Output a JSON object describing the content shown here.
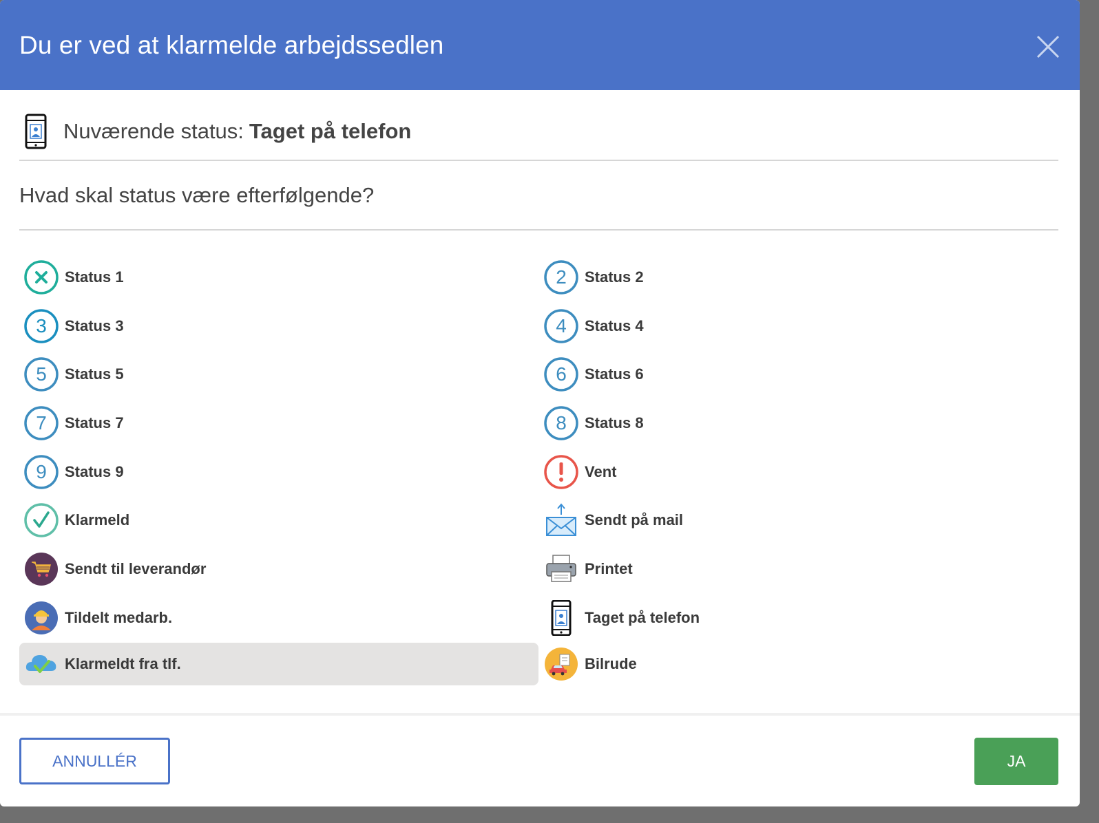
{
  "dialog": {
    "title": "Du er ved at klarmelde arbejdssedlen",
    "current_status_label": "Nuværende status:",
    "current_status_value": "Taget på telefon",
    "question": "Hvad skal status være efterfølgende?"
  },
  "options": {
    "left": [
      {
        "label": "Status 1",
        "icon": "x-circle-icon"
      },
      {
        "label": "Status 3",
        "icon": "number-3-circle-icon"
      },
      {
        "label": "Status 5",
        "icon": "number-5-circle-icon"
      },
      {
        "label": "Status 7",
        "icon": "number-7-circle-icon"
      },
      {
        "label": "Status 9",
        "icon": "number-9-circle-icon"
      },
      {
        "label": "Klarmeld",
        "icon": "check-circle-icon"
      },
      {
        "label": "Sendt til leverandør",
        "icon": "shopping-cart-icon"
      },
      {
        "label": "Tildelt medarb.",
        "icon": "worker-icon"
      },
      {
        "label": "Klarmeldt fra tlf.",
        "icon": "cloud-check-icon",
        "selected": true
      }
    ],
    "right": [
      {
        "label": "Status 2",
        "icon": "number-2-circle-icon"
      },
      {
        "label": "Status 4",
        "icon": "number-4-circle-icon"
      },
      {
        "label": "Status 6",
        "icon": "number-6-circle-icon"
      },
      {
        "label": "Status 8",
        "icon": "number-8-circle-icon"
      },
      {
        "label": "Vent",
        "icon": "exclamation-circle-icon"
      },
      {
        "label": "Sendt på mail",
        "icon": "mail-send-icon"
      },
      {
        "label": "Printet",
        "icon": "printer-icon"
      },
      {
        "label": "Taget på telefon",
        "icon": "phone-icon"
      },
      {
        "label": "Bilrude",
        "icon": "car-windshield-icon"
      }
    ]
  },
  "buttons": {
    "cancel": "ANNULLÉR",
    "confirm": "JA"
  },
  "colors": {
    "header": "#4a72c8",
    "confirm": "#4aa057",
    "teal": "#1fae9b",
    "blue_circle": "#3d8dbf",
    "red": "#e8554a",
    "selected_bg": "#e4e3e2"
  }
}
